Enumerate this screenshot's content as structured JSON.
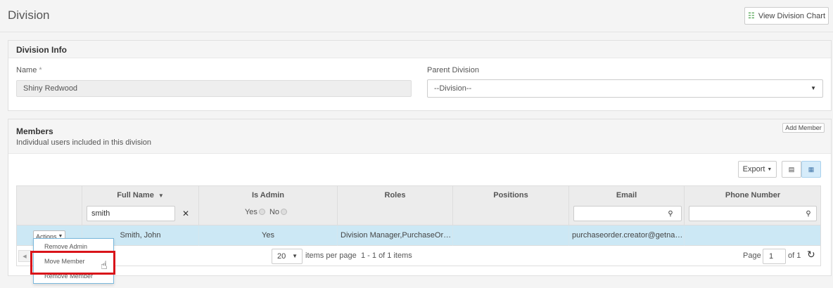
{
  "header": {
    "title": "Division",
    "view_chart_label": "View Division Chart"
  },
  "division_info": {
    "title": "Division Info",
    "name_label": "Name",
    "required_marker": "*",
    "name_value": "Shiny Redwood",
    "parent_label": "Parent Division",
    "parent_value": "--Division--"
  },
  "members": {
    "title": "Members",
    "subtitle": "Individual users included in this division",
    "add_member_label": "Add Member",
    "export_label": "Export",
    "columns": {
      "full_name": "Full Name",
      "is_admin": "Is Admin",
      "roles": "Roles",
      "positions": "Positions",
      "email": "Email",
      "phone": "Phone Number"
    },
    "filters": {
      "full_name_value": "smith",
      "yes_label": "Yes",
      "no_label": "No",
      "email_value": "",
      "phone_value": ""
    },
    "rows": [
      {
        "actions_label": "Actions",
        "full_name": "Smith, John",
        "is_admin": "Yes",
        "roles": "Division Manager,PurchaseOrd…",
        "positions": "",
        "email": "purchaseorder.creator@getnad…",
        "phone": ""
      }
    ],
    "pager": {
      "page_size": "20",
      "items_per_page_label": "items per page",
      "items_info": "1 - 1 of 1 items",
      "page_label": "Page",
      "page_value": "1",
      "of_label": "of 1"
    },
    "actions_menu": {
      "remove_admin": "Remove Admin",
      "move_member": "Move Member",
      "remove_member": "Remove Member"
    }
  },
  "colors": {
    "selected_row": "#cce8f5",
    "highlight": "#d9141a",
    "chart_icon": "#3c9a3c"
  }
}
